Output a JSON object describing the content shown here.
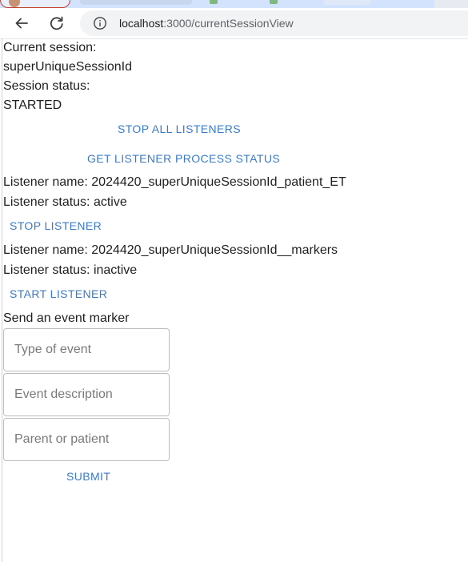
{
  "browser": {
    "url_host": "localhost",
    "url_path": ":3000/currentSessionView"
  },
  "session": {
    "label": "Current session:",
    "id": "superUniqueSessionId",
    "status_label": "Session status:",
    "status": "STARTED"
  },
  "actions": {
    "stop_all": "STOP ALL LISTENERS",
    "get_status": "GET LISTENER PROCESS STATUS"
  },
  "listeners": [
    {
      "name_line": "Listener name: 2024420_superUniqueSessionId_patient_ET",
      "status_line": "Listener status: active",
      "button": "STOP LISTENER"
    },
    {
      "name_line": "Listener name: 2024420_superUniqueSessionId__markers",
      "status_line": "Listener status: inactive",
      "button": "START LISTENER"
    }
  ],
  "marker_form": {
    "heading": "Send an event marker",
    "event_type_placeholder": "Type of event",
    "event_description_placeholder": "Event description",
    "parent_or_patient_placeholder": "Parent or patient",
    "submit": "SUBMIT"
  },
  "colors": {
    "accent": "#3a7bc8",
    "field_border": "#bdbdbd"
  }
}
